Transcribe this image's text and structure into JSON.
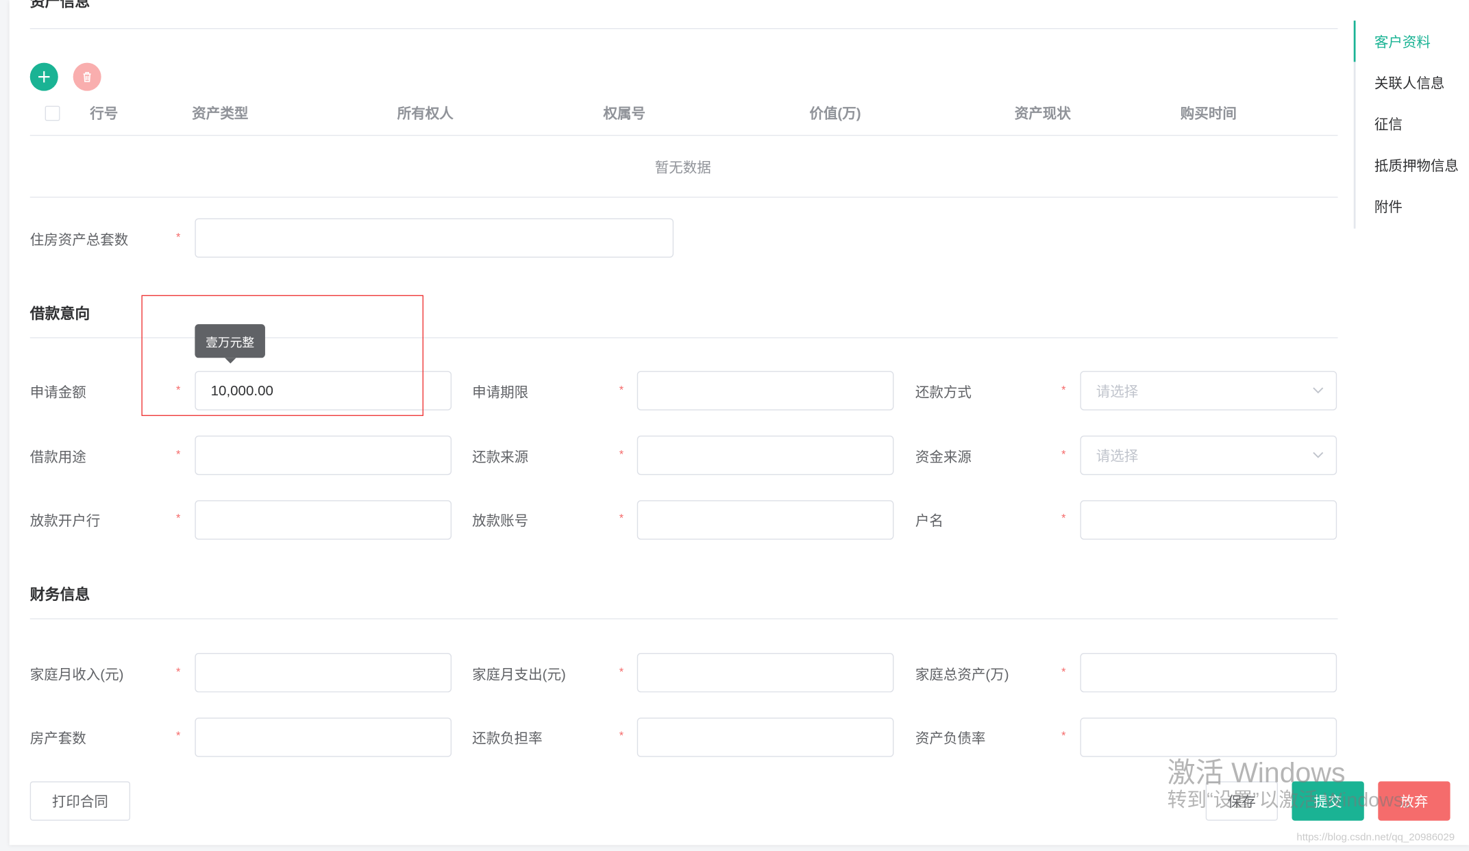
{
  "asset_section": {
    "title": "资产信息",
    "table_headers": [
      "行号",
      "资产类型",
      "所有权人",
      "权属号",
      "价值(万)",
      "资产现状",
      "购买时间"
    ],
    "empty_text": "暂无数据",
    "housing_total_label": "住房资产总套数",
    "housing_total_value": ""
  },
  "loan_section": {
    "title": "借款意向",
    "tooltip": "壹万元整",
    "fields": [
      {
        "label": "申请金额",
        "value": "10,000.00"
      },
      {
        "label": "申请期限",
        "value": ""
      },
      {
        "label": "还款方式",
        "placeholder": "请选择"
      },
      {
        "label": "借款用途",
        "value": ""
      },
      {
        "label": "还款来源",
        "value": ""
      },
      {
        "label": "资金来源",
        "placeholder": "请选择"
      },
      {
        "label": "放款开户行",
        "value": ""
      },
      {
        "label": "放款账号",
        "value": ""
      },
      {
        "label": "户名",
        "value": ""
      }
    ]
  },
  "finance_section": {
    "title": "财务信息",
    "fields": [
      {
        "label": "家庭月收入(元)",
        "value": ""
      },
      {
        "label": "家庭月支出(元)",
        "value": ""
      },
      {
        "label": "家庭总资产(万)",
        "value": ""
      },
      {
        "label": "房产套数",
        "value": ""
      },
      {
        "label": "还款负担率",
        "value": ""
      },
      {
        "label": "资产负债率",
        "value": ""
      }
    ]
  },
  "required_mark": "*",
  "anchors": [
    "客户资料",
    "关联人信息",
    "征信",
    "抵质押物信息",
    "附件"
  ],
  "buttons": {
    "print_contract": "打印合同",
    "save": "保存",
    "submit": "提交",
    "abandon": "放弃"
  },
  "watermark": {
    "line1": "激活 Windows",
    "line2": "转到“设置”以激活 Windows。",
    "url": "https://blog.csdn.net/qq_20986029"
  },
  "colors": {
    "primary": "#1ab394",
    "danger": "#f56c6c",
    "delete_disabled": "#f9aeae",
    "tooltip_bg": "#606266",
    "annotation_red": "#e33333"
  }
}
